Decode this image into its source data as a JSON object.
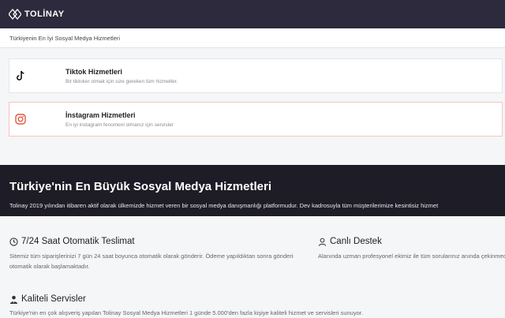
{
  "header": {
    "logo_text": "TOLİNAY"
  },
  "breadcrumb": "Türkiyenin En İyi Sosyal Medya Hizmetleri",
  "services": [
    {
      "title": "Tiktok Hizmetleri",
      "desc": "Bir tiktoker olmak için size gereken tüm hizmetler.",
      "icon": "tiktok-icon"
    },
    {
      "title": "İnstagram Hizmetleri",
      "desc": "En iyi instagram fenomeni olmanız için servisler",
      "icon": "instagram-icon"
    }
  ],
  "hero": {
    "title": "Türkiye'nin En Büyük Sosyal Medya Hizmetleri",
    "desc": "Tolinay 2019 yılından itibaren aktif olarak ülkemizde hizmet veren bir sosyal medya danışmanlığı platformudur. Dev kadrosuyla tüm müşterilerimize kesintisiz hizmet"
  },
  "features": [
    {
      "title": "7/24 Saat Otomatik Teslimat",
      "icon": "clock-icon",
      "text": "Sitemiz tüm siparişlerinizi 7 gün 24 saat boyunca otomatik olarak gönderir. Ödeme yapıldıktan sonra gönderim otomatik olarak başlamaktadır."
    },
    {
      "title": "Canlı Destek",
      "icon": "user-support-icon",
      "text": "Alanında uzman profesyonel ekimiz ile tüm sorularınız anında çekinmeden canlı destek üzerinden iletebilirsiniz."
    },
    {
      "title": "Kaliteli Servisler",
      "icon": "user-tie-icon",
      "text": "Türkiye'nin en çok alışveriş yapılan Tolinay Sosyal Medya Hizmetleri 1 günde 5.000'den fazla kişiye kaliteli hizmet ve servisleri sunuyor."
    }
  ],
  "colors": {
    "header_bg": "#2c2a3c",
    "hero_bg": "#1e1c26",
    "instagram_accent": "#e4573d"
  }
}
